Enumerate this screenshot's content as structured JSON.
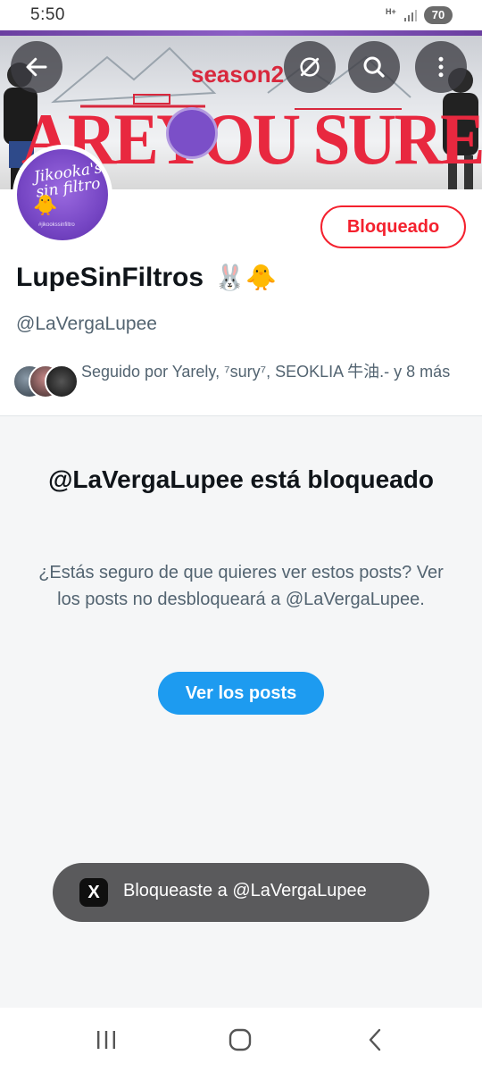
{
  "status_bar": {
    "time": "5:50",
    "network": "H+",
    "battery": "70"
  },
  "banner": {
    "season_text": "season2",
    "title_text": "AREYOU SURE?!"
  },
  "avatar": {
    "script_text": "Jikooka's sin filtro",
    "tag_text": "#jikookssinfiltro"
  },
  "profile": {
    "blocked_label": "Bloqueado",
    "display_name": "LupeSinFiltros",
    "name_emojis": "🐰🐥",
    "handle": "@LaVergaLupee",
    "followed_by": "Seguido por Yarely, ⁷sury⁷, SEOKLIA 牛油.- y 8 más"
  },
  "blocked_panel": {
    "title": "@LaVergaLupee está bloqueado",
    "description": "¿Estás seguro de que quieres ver estos posts? Ver los posts no desbloqueará a @LaVergaLupee.",
    "button_label": "Ver los posts"
  },
  "toast": {
    "icon": "X",
    "text": "Bloqueaste a @LaVergaLupee"
  },
  "icons": {
    "back": "arrow-left-icon",
    "discover": "grok-icon",
    "search": "search-icon",
    "more": "more-vertical-icon"
  },
  "colors": {
    "blocked_red": "#f4212e",
    "primary_blue": "#1d9bf0",
    "toast_bg": "#5a5a5c",
    "secondary_text": "#536471"
  }
}
